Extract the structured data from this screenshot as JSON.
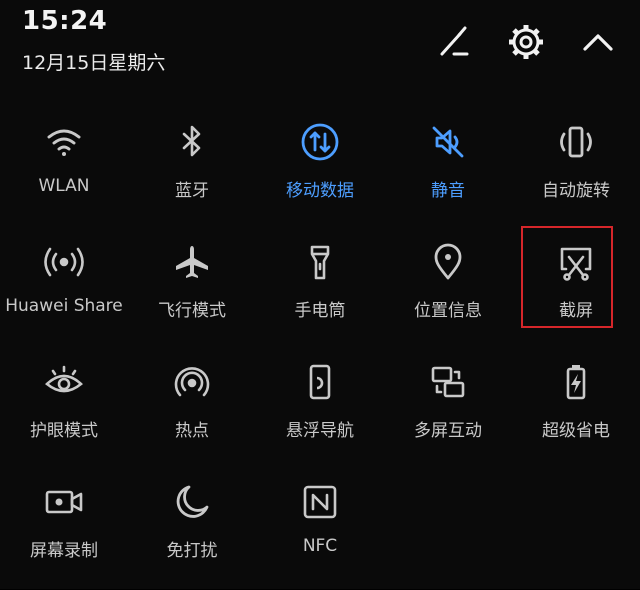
{
  "status": {
    "time": "15:24",
    "date": "12月15日星期六"
  },
  "header_icons": [
    "edit-icon",
    "gear-icon",
    "chevron-up-icon"
  ],
  "colors": {
    "background": "#0a0a0a",
    "icon": "#c9c9c9",
    "active": "#4d9eff",
    "highlight": "#d6262a"
  },
  "tiles": [
    {
      "label": "WLAN",
      "icon": "wifi-icon",
      "active": false
    },
    {
      "label": "蓝牙",
      "icon": "bluetooth-icon",
      "active": false
    },
    {
      "label": "移动数据",
      "icon": "mobile-data-icon",
      "active": true
    },
    {
      "label": "静音",
      "icon": "mute-icon",
      "active": true
    },
    {
      "label": "自动旋转",
      "icon": "auto-rotate-icon",
      "active": false
    },
    {
      "label": "Huawei Share",
      "icon": "huawei-share-icon",
      "active": false
    },
    {
      "label": "飞行模式",
      "icon": "airplane-icon",
      "active": false
    },
    {
      "label": "手电筒",
      "icon": "flashlight-icon",
      "active": false
    },
    {
      "label": "位置信息",
      "icon": "location-icon",
      "active": false
    },
    {
      "label": "截屏",
      "icon": "screenshot-icon",
      "active": false
    },
    {
      "label": "护眼模式",
      "icon": "eye-icon",
      "active": false
    },
    {
      "label": "热点",
      "icon": "hotspot-icon",
      "active": false
    },
    {
      "label": "悬浮导航",
      "icon": "floating-nav-icon",
      "active": false
    },
    {
      "label": "多屏互动",
      "icon": "multi-screen-icon",
      "active": false
    },
    {
      "label": "超级省电",
      "icon": "battery-saver-icon",
      "active": false
    },
    {
      "label": "屏幕录制",
      "icon": "screen-record-icon",
      "active": false
    },
    {
      "label": "免打扰",
      "icon": "moon-icon",
      "active": false
    },
    {
      "label": "NFC",
      "icon": "nfc-icon",
      "active": false
    }
  ]
}
